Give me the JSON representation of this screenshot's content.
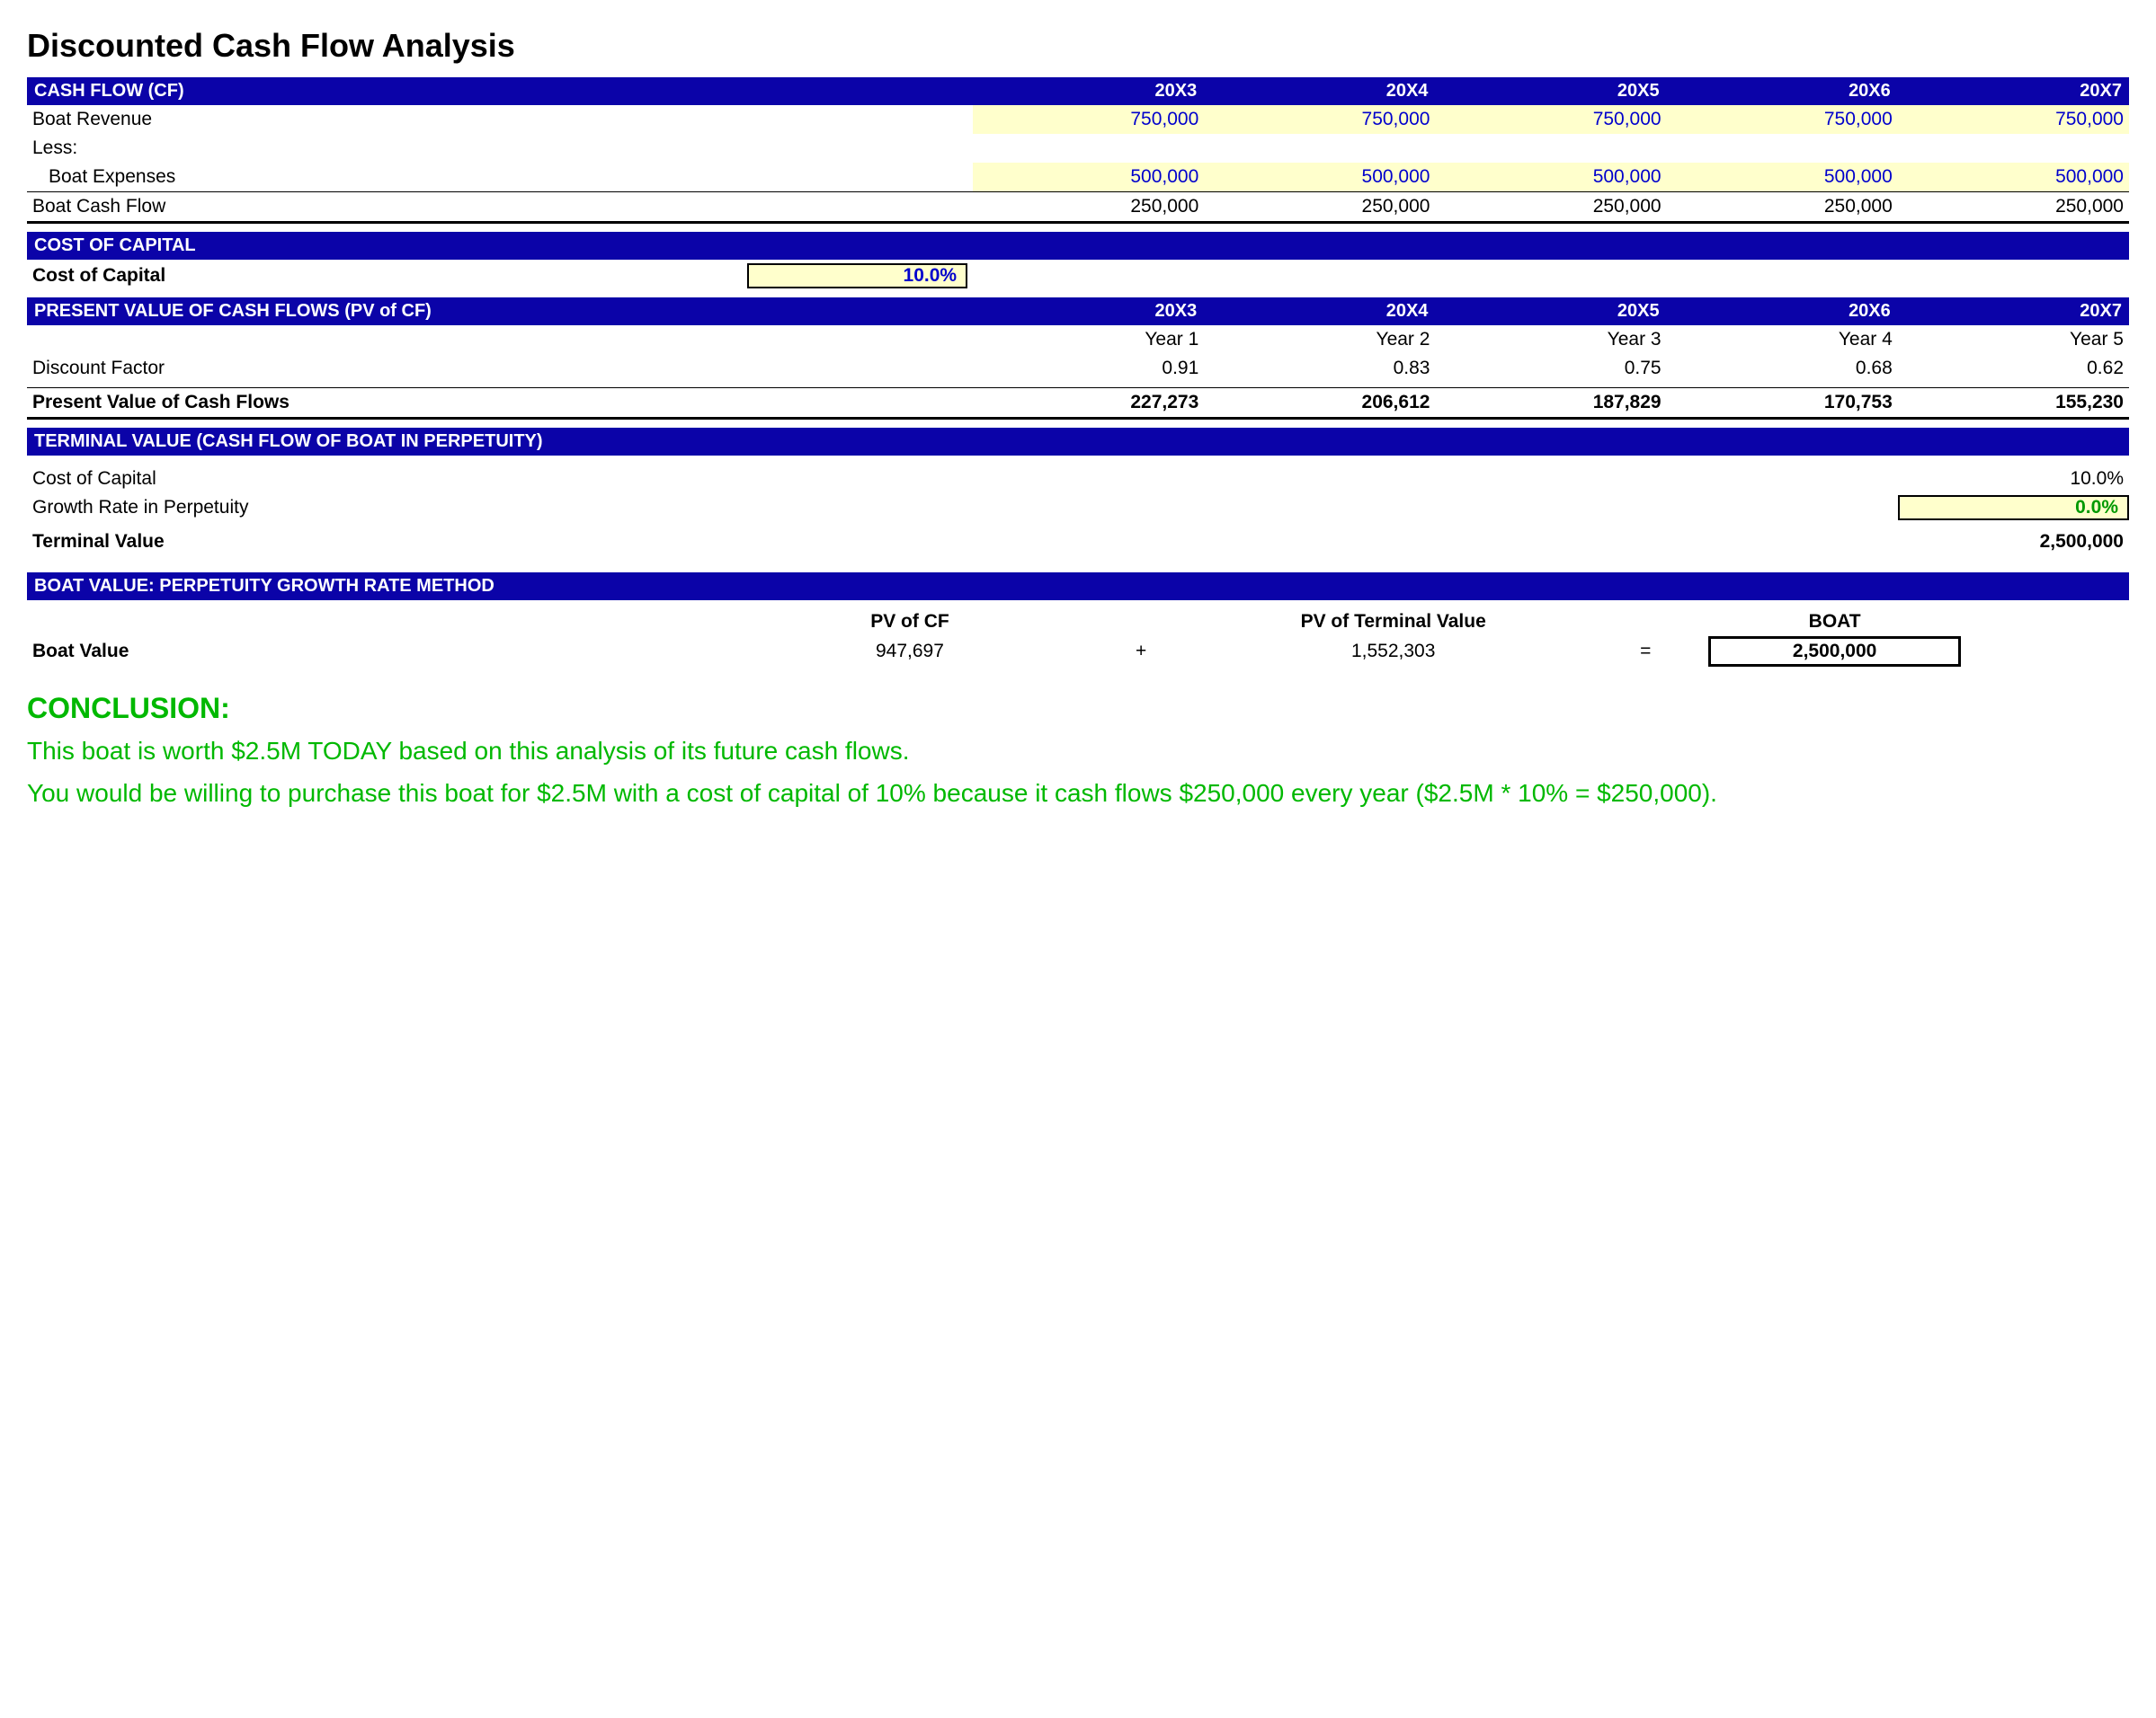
{
  "title": "Discounted Cash Flow Analysis",
  "years": [
    "20X3",
    "20X4",
    "20X5",
    "20X6",
    "20X7"
  ],
  "cashflow": {
    "header": "CASH FLOW (CF)",
    "revenue_label": "Boat Revenue",
    "revenue": [
      "750,000",
      "750,000",
      "750,000",
      "750,000",
      "750,000"
    ],
    "less_label": "Less:",
    "expenses_label": "Boat Expenses",
    "expenses": [
      "500,000",
      "500,000",
      "500,000",
      "500,000",
      "500,000"
    ],
    "net_label": "Boat Cash Flow",
    "net": [
      "250,000",
      "250,000",
      "250,000",
      "250,000",
      "250,000"
    ]
  },
  "coc": {
    "header": "COST OF CAPITAL",
    "label": "Cost of Capital",
    "value": "10.0%"
  },
  "pv": {
    "header": "PRESENT VALUE OF CASH FLOWS (PV of CF)",
    "year_labels": [
      "Year 1",
      "Year 2",
      "Year 3",
      "Year 4",
      "Year 5"
    ],
    "df_label": "Discount Factor",
    "df": [
      "0.91",
      "0.83",
      "0.75",
      "0.68",
      "0.62"
    ],
    "pv_label": "Present Value of Cash Flows",
    "pv_values": [
      "227,273",
      "206,612",
      "187,829",
      "170,753",
      "155,230"
    ]
  },
  "terminal": {
    "header": "TERMINAL VALUE (CASH FLOW OF BOAT IN PERPETUITY)",
    "coc_label": "Cost of Capital",
    "coc_value": "10.0%",
    "growth_label": "Growth Rate in Perpetuity",
    "growth_value": "0.0%",
    "tv_label": "Terminal Value",
    "tv_value": "2,500,000"
  },
  "boatvalue": {
    "header": "BOAT VALUE: PERPETUITY GROWTH RATE METHOD",
    "col1": "PV of CF",
    "col2": "PV of Terminal Value",
    "col3": "BOAT",
    "label": "Boat Value",
    "pv_of_cf": "947,697",
    "plus": "+",
    "pv_of_tv": "1,552,303",
    "equals": "=",
    "result": "2,500,000"
  },
  "conclusion": {
    "heading": "CONCLUSION:",
    "line1": "This boat is worth $2.5M TODAY based on this analysis of its future cash flows.",
    "line2": "You would be willing to purchase this boat for $2.5M with a cost of capital of 10% because it cash flows $250,000 every year ($2.5M * 10% = $250,000)."
  }
}
